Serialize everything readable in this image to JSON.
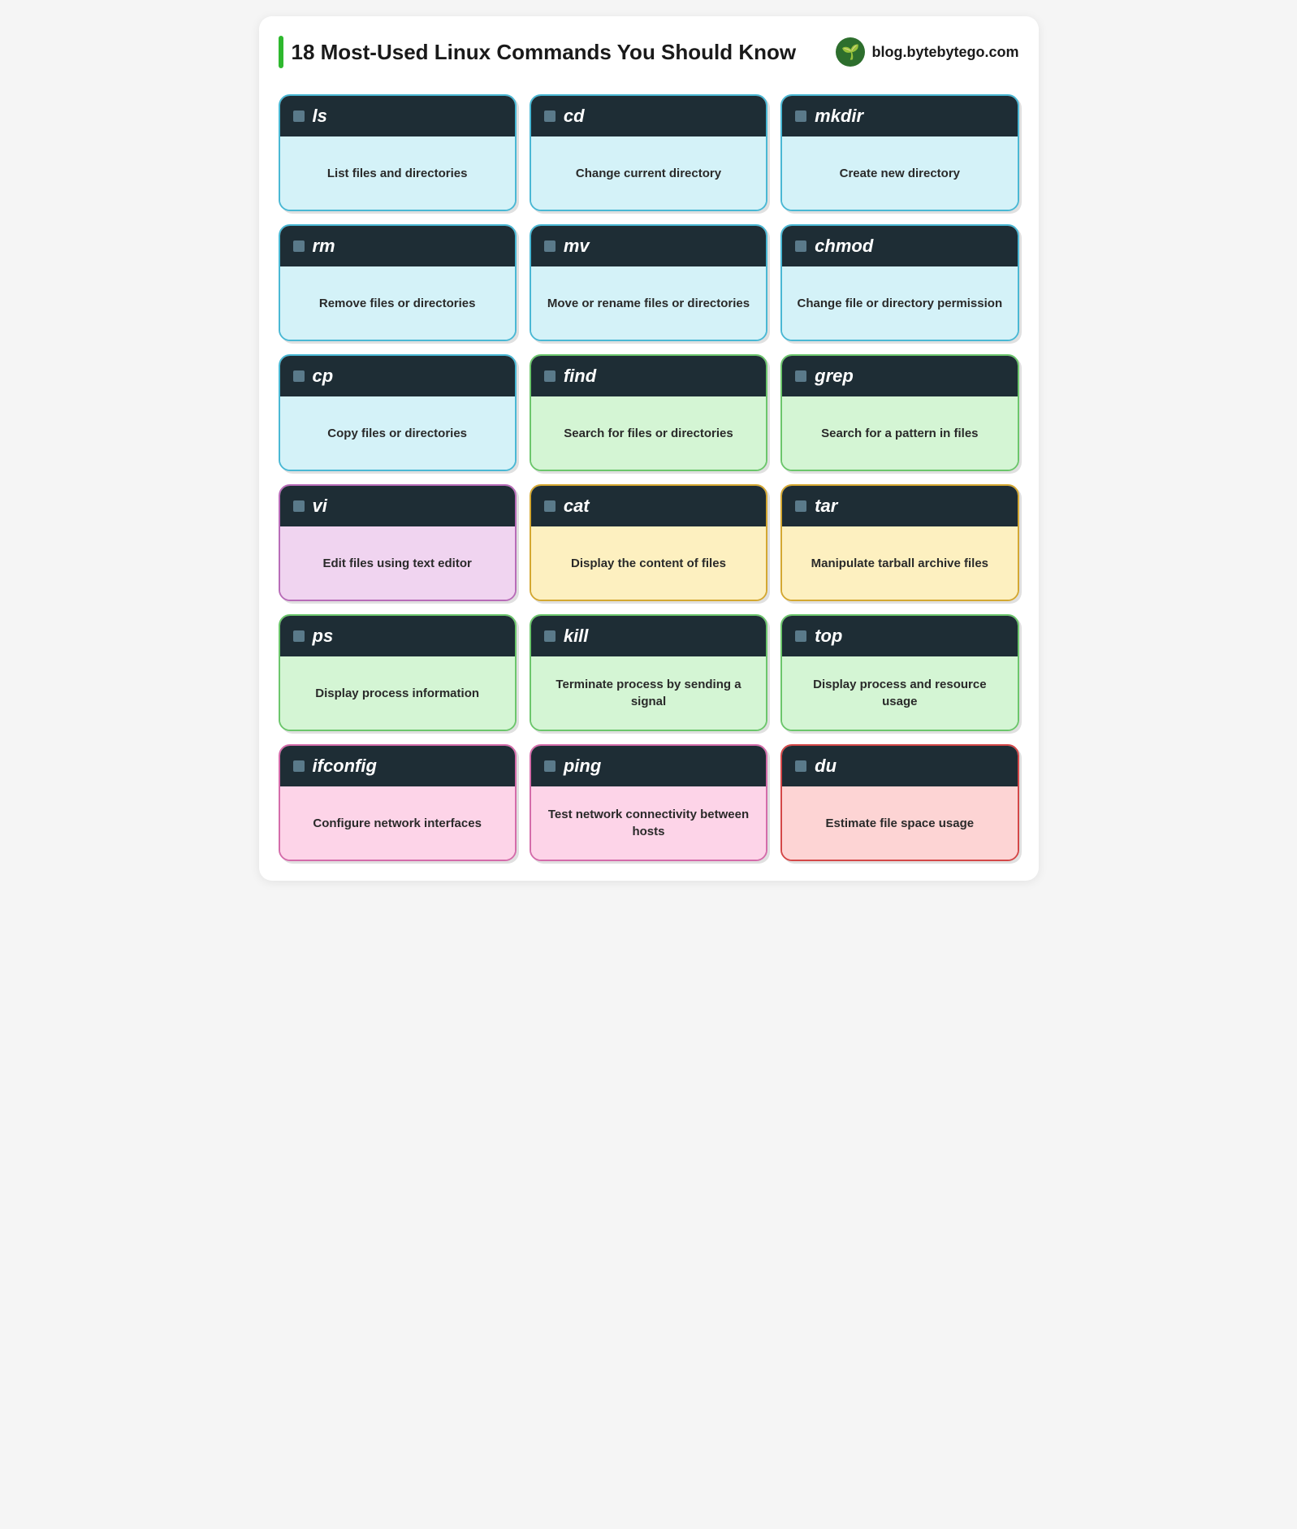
{
  "header": {
    "title": "18 Most-Used Linux Commands You Should Know",
    "brand": "blog.bytebytego.com",
    "accent_color": "#2eb82e",
    "brand_icon": "🌱"
  },
  "commands": [
    {
      "cmd": "ls",
      "desc": "List files and directories",
      "theme": "blue"
    },
    {
      "cmd": "cd",
      "desc": "Change current directory",
      "theme": "blue"
    },
    {
      "cmd": "mkdir",
      "desc": "Create new directory",
      "theme": "blue"
    },
    {
      "cmd": "rm",
      "desc": "Remove files or directories",
      "theme": "blue"
    },
    {
      "cmd": "mv",
      "desc": "Move or rename files or directories",
      "theme": "blue"
    },
    {
      "cmd": "chmod",
      "desc": "Change file or directory permission",
      "theme": "blue"
    },
    {
      "cmd": "cp",
      "desc": "Copy files or directories",
      "theme": "blue"
    },
    {
      "cmd": "find",
      "desc": "Search for files or directories",
      "theme": "green"
    },
    {
      "cmd": "grep",
      "desc": "Search for a pattern in files",
      "theme": "green"
    },
    {
      "cmd": "vi",
      "desc": "Edit files using text editor",
      "theme": "purple"
    },
    {
      "cmd": "cat",
      "desc": "Display the content of files",
      "theme": "yellow"
    },
    {
      "cmd": "tar",
      "desc": "Manipulate tarball archive files",
      "theme": "yellow"
    },
    {
      "cmd": "ps",
      "desc": "Display process information",
      "theme": "green"
    },
    {
      "cmd": "kill",
      "desc": "Terminate process by sending a signal",
      "theme": "green"
    },
    {
      "cmd": "top",
      "desc": "Display process and resource usage",
      "theme": "green"
    },
    {
      "cmd": "ifconfig",
      "desc": "Configure network interfaces",
      "theme": "pink"
    },
    {
      "cmd": "ping",
      "desc": "Test network connectivity between hosts",
      "theme": "pink"
    },
    {
      "cmd": "du",
      "desc": "Estimate file space usage",
      "theme": "red"
    }
  ]
}
